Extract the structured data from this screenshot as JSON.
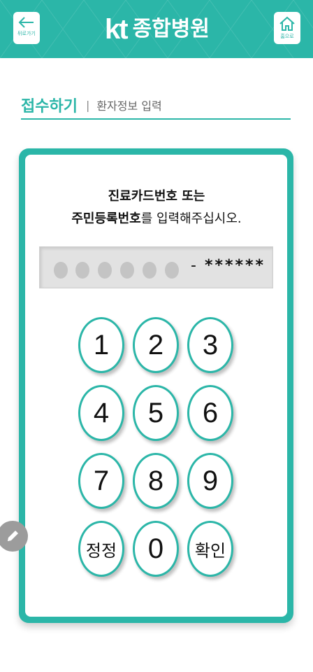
{
  "header": {
    "back_label": "뒤로가기",
    "home_label": "홈으로",
    "brand_logo": "kt",
    "brand_name": "종합병원"
  },
  "title": {
    "main": "접수하기",
    "separator": "|",
    "sub": "환자정보 입력"
  },
  "instruction": {
    "line1_bold": "진료카드번호 또는",
    "line2_bold": "주민등록번호",
    "line2_rest": "를 입력해주십시오."
  },
  "display": {
    "dash": "-",
    "masked": "******"
  },
  "keypad": {
    "k1": "1",
    "k2": "2",
    "k3": "3",
    "k4": "4",
    "k5": "5",
    "k6": "6",
    "k7": "7",
    "k8": "8",
    "k9": "9",
    "clear": "정정",
    "k0": "0",
    "confirm": "확인"
  },
  "colors": {
    "accent": "#2bb6a8",
    "display_bg": "#e2e2e2",
    "dot": "#c4c4c4",
    "floating_button": "#9c9c9c"
  },
  "icons": {
    "back": "arrow-left-icon",
    "home": "home-icon",
    "floating": "pencil-icon"
  }
}
